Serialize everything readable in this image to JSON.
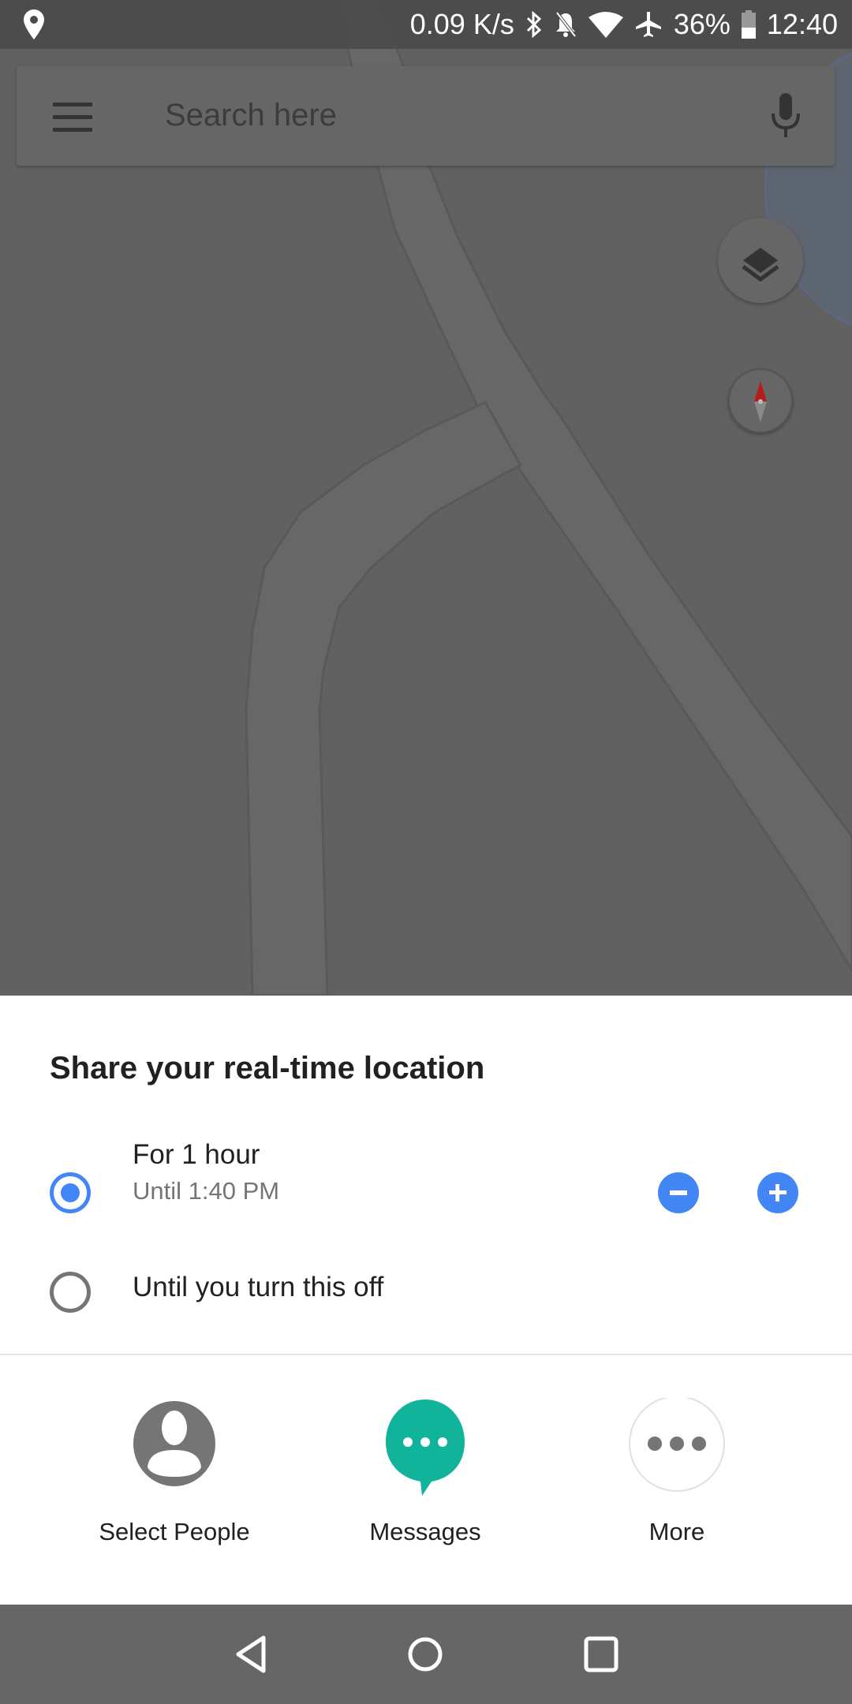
{
  "status_bar": {
    "left_icon": "location-pin-icon",
    "net_speed": "0.09 K/s",
    "icons": [
      "bluetooth-icon",
      "notifications-off-icon",
      "wifi-icon",
      "airplane-mode-icon"
    ],
    "battery": "36%",
    "time": "12:40"
  },
  "search": {
    "placeholder": "Search here",
    "menu_icon": "hamburger-menu-icon",
    "voice_icon": "microphone-icon"
  },
  "map_controls": {
    "layers_icon": "layers-icon",
    "compass_icon": "compass-icon"
  },
  "sheet": {
    "title": "Share your real-time location",
    "options": [
      {
        "label": "For 1 hour",
        "sublabel": "Until 1:40 PM",
        "selected": true
      },
      {
        "label": "Until you turn this off",
        "selected": false
      }
    ],
    "decrease_icon": "minus-circle-icon",
    "increase_icon": "plus-circle-icon",
    "share_targets": [
      {
        "label": "Select People",
        "icon": "person-icon"
      },
      {
        "label": "Messages",
        "icon": "messages-icon"
      },
      {
        "label": "More",
        "icon": "more-horiz-icon"
      }
    ]
  },
  "colors": {
    "accent": "#4285f4",
    "messages_teal": "#11b39b",
    "scrim_map": "#616161"
  },
  "nav_bar": {
    "back_icon": "back-icon",
    "home_icon": "home-icon",
    "recents_icon": "recents-icon"
  }
}
